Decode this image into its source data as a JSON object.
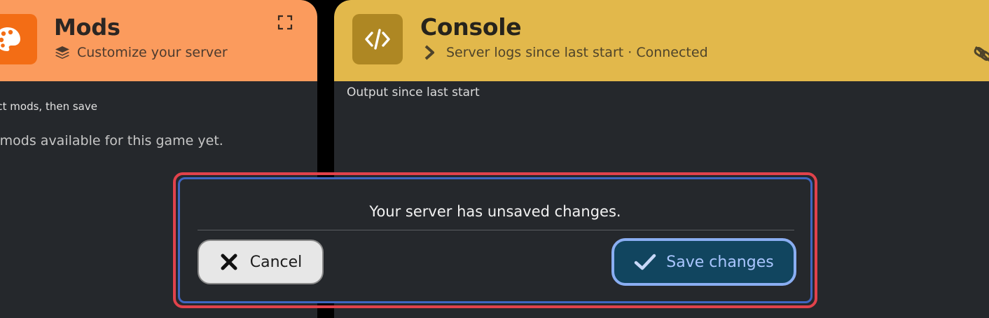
{
  "mods_panel": {
    "title": "Mods",
    "subtitle": "Customize your server",
    "note": "lect mods, then save",
    "empty_message": "o mods available for this game yet.",
    "icons": {
      "main": "palette-icon",
      "subtitle": "layers-icon",
      "action": "expand-icon"
    },
    "colors": {
      "header": "#fb9b5d",
      "icon_box": "#f36d15"
    }
  },
  "console_panel": {
    "title": "Console",
    "subtitle": "Server logs since last start · Connected",
    "output_label": "Output since last start",
    "icons": {
      "main": "code-icon",
      "subtitle": "chevron-right-icon",
      "action": "link-off-icon"
    },
    "colors": {
      "header": "#e2b84b",
      "icon_box": "#ae8723"
    }
  },
  "unsaved_modal": {
    "message": "Your server has unsaved changes.",
    "cancel_label": "Cancel",
    "save_label": "Save changes",
    "icons": {
      "cancel": "close-icon",
      "save": "check-icon"
    },
    "colors": {
      "highlight_border": "#e1424b",
      "modal_border": "#3f66c1",
      "save_bg": "#11455f"
    }
  }
}
